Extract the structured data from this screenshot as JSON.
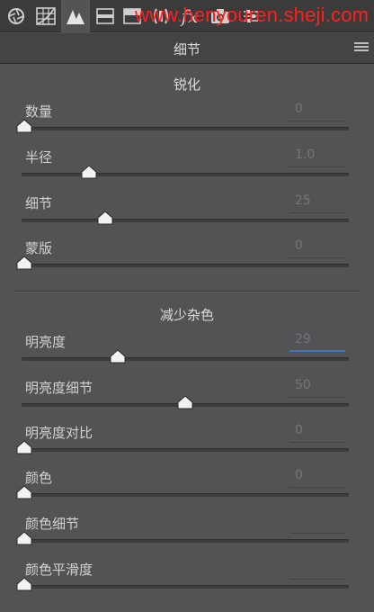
{
  "toolbar": {
    "tools": [
      {
        "id": "basic",
        "icon": "aperture-icon"
      },
      {
        "id": "tone-curve",
        "icon": "grid-curve-icon"
      },
      {
        "id": "detail",
        "icon": "triangles-icon",
        "active": true
      },
      {
        "id": "hsl",
        "icon": "hsl-icon"
      },
      {
        "id": "split-toning",
        "icon": "split-toning-icon"
      },
      {
        "id": "lens",
        "icon": "lens-icon"
      },
      {
        "id": "effects",
        "icon": "fx-icon"
      },
      {
        "id": "camera",
        "icon": "camera-icon"
      },
      {
        "id": "presets",
        "icon": "sliders-icon"
      }
    ],
    "fx_label": "fx",
    "watermark": "www.henyouren.sheji.com"
  },
  "panel": {
    "title": "细节",
    "menu_icon": "menu-lines-icon"
  },
  "sharpening": {
    "title": "锐化",
    "rows": [
      {
        "label": "数量",
        "value": "0",
        "fraction": 0.0
      },
      {
        "label": "半径",
        "value": "1.0",
        "fraction": 0.2
      },
      {
        "label": "细节",
        "value": "25",
        "fraction": 0.25
      },
      {
        "label": "蒙版",
        "value": "0",
        "fraction": 0.0
      }
    ]
  },
  "noise_reduction": {
    "title": "减少杂色",
    "rows": [
      {
        "label": "明亮度",
        "value": "29",
        "fraction": 0.29,
        "focused": true
      },
      {
        "label": "明亮度细节",
        "value": "50",
        "fraction": 0.5
      },
      {
        "label": "明亮度对比",
        "value": "0",
        "fraction": 0.0
      },
      {
        "label": "颜色",
        "value": "0",
        "fraction": 0.0
      },
      {
        "label": "颜色细节",
        "value": "",
        "fraction": 0.0
      },
      {
        "label": "颜色平滑度",
        "value": "",
        "fraction": 0.0
      }
    ]
  },
  "colors": {
    "background": "#535353",
    "toolbar": "#3b3b3b",
    "header": "#444444",
    "focus_accent": "#3f78c0",
    "watermark": "#ff1f1f"
  }
}
